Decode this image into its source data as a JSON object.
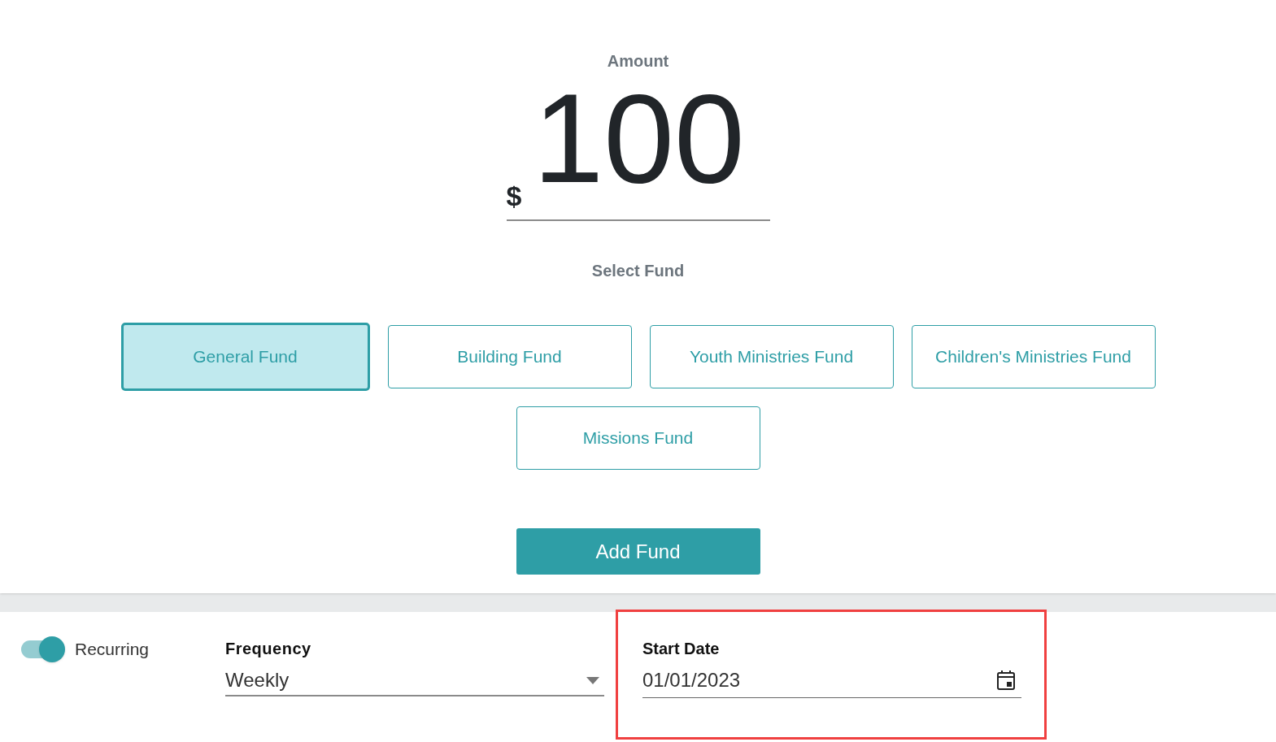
{
  "amount": {
    "label": "Amount",
    "currency": "$",
    "value": "100"
  },
  "fund_section": {
    "label": "Select Fund"
  },
  "funds": [
    {
      "label": "General Fund",
      "selected": true
    },
    {
      "label": "Building Fund",
      "selected": false
    },
    {
      "label": "Youth Ministries Fund",
      "selected": false
    },
    {
      "label": "Children's Ministries Fund",
      "selected": false
    },
    {
      "label": "Missions Fund",
      "selected": false
    }
  ],
  "add_button": "Add Fund",
  "recurring": {
    "label": "Recurring",
    "on": true
  },
  "frequency": {
    "label": "Frequency",
    "value": "Weekly"
  },
  "start_date": {
    "label": "Start Date",
    "value": "01/01/2023",
    "highlighted": true
  }
}
